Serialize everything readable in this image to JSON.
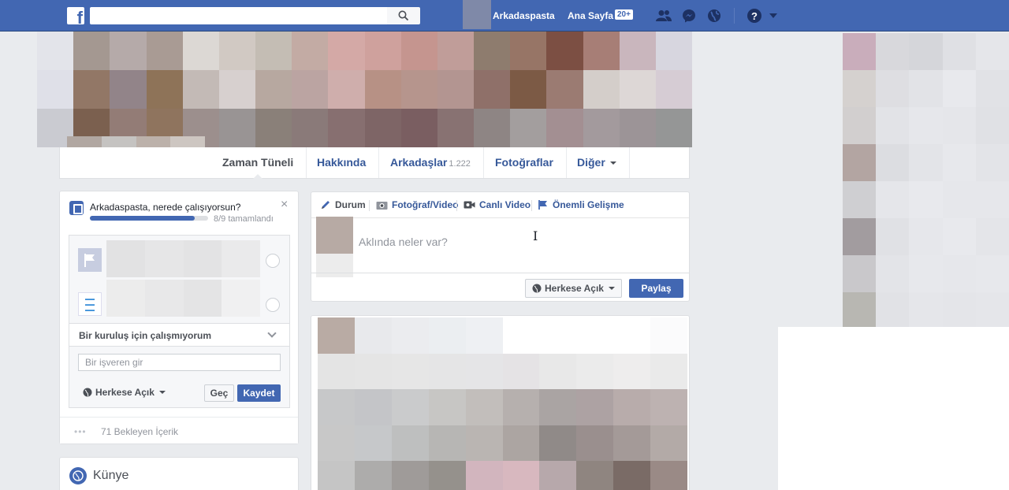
{
  "topbar": {
    "logo_letter": "f",
    "search_placeholder": "",
    "profile_name": "Arkadaspasta",
    "home_label": "Ana Sayfa",
    "home_badge": "20+",
    "icons": [
      "friends-icon",
      "messenger-icon",
      "notifications-globe-icon",
      "help-icon",
      "account-caret-icon"
    ]
  },
  "profile_nav": {
    "tabs": [
      {
        "label": "Zaman Tüneli"
      },
      {
        "label": "Hakkında"
      },
      {
        "label": "Arkadaşlar",
        "count": "1.222"
      },
      {
        "label": "Fotoğraflar"
      },
      {
        "label": "Diğer"
      }
    ]
  },
  "work_card": {
    "question": "Arkadaspasta, nerede çalışıyorsun?",
    "progress_text": "8/9 tamamlandı",
    "progress_fraction": 0.889,
    "no_business_label": "Bir kuruluş için çalışmıyorum",
    "employer_placeholder": "Bir işveren gir",
    "privacy_label": "Herkese Açık",
    "skip_label": "Geç",
    "save_label": "Kaydet",
    "close_glyph": "×"
  },
  "pending": {
    "text": "71 Bekleyen İçerik"
  },
  "kunye": {
    "title": "Künye"
  },
  "composer": {
    "tabs": [
      {
        "label": "Durum",
        "icon": "pencil-icon"
      },
      {
        "label": "Fotoğraf/Video",
        "icon": "camera-icon"
      },
      {
        "label": "Canlı Video",
        "icon": "video-camera-icon"
      },
      {
        "label": "Önemli Gelişme",
        "icon": "flag-icon"
      }
    ],
    "placeholder": "Aklında neler var?",
    "audience_label": "Herkese Açık",
    "share_label": "Paylaş"
  },
  "colors": {
    "brand": "#4267b2",
    "link": "#365899",
    "background": "#e9ebee"
  }
}
